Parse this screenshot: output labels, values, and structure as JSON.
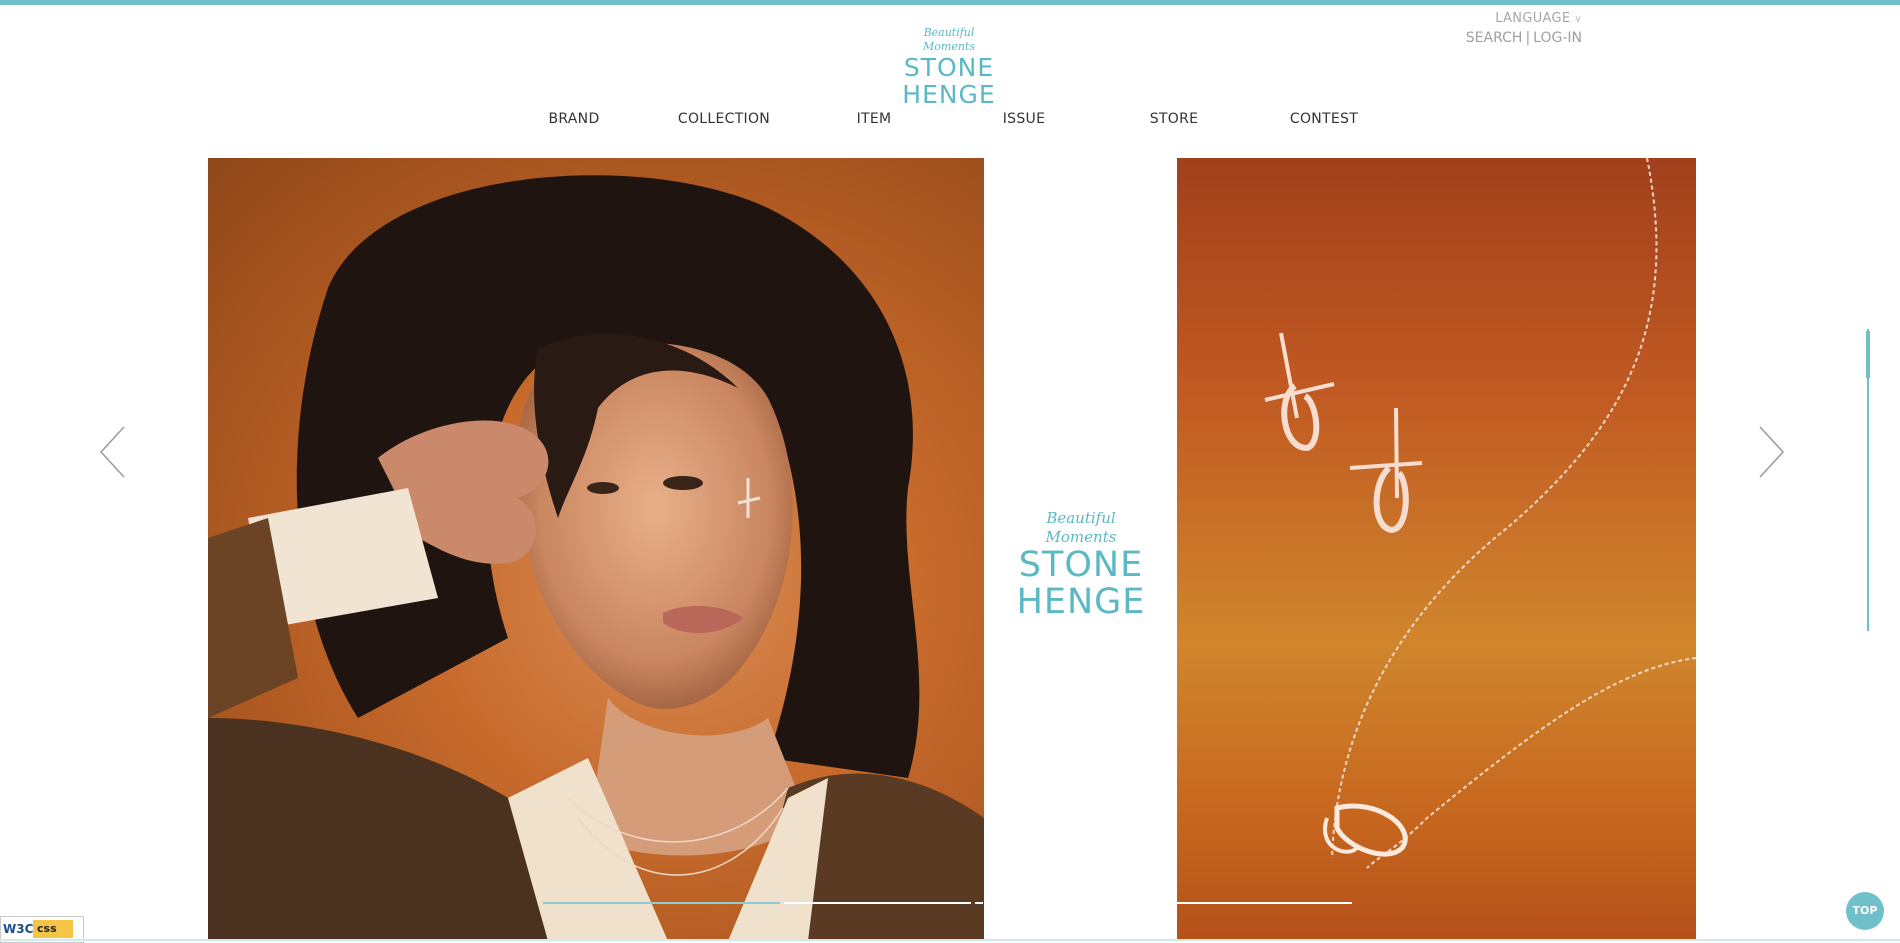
{
  "header": {
    "logo": {
      "tagline": "Beautiful Moments",
      "line1": "STONE",
      "line2": "HENGE"
    },
    "language": {
      "label": "LANGUAGE",
      "chevron": "∨"
    },
    "util_links": {
      "search": "SEARCH",
      "separator": "|",
      "login": "LOG-IN"
    }
  },
  "nav": {
    "items": [
      {
        "label": "BRAND"
      },
      {
        "label": "COLLECTION"
      },
      {
        "label": "ITEM"
      },
      {
        "label": "ISSUE"
      },
      {
        "label": "STORE"
      },
      {
        "label": "CONTEST"
      }
    ]
  },
  "slider": {
    "center_logo": {
      "tagline": "Beautiful Moments",
      "line1": "STONE",
      "line2": "HENGE"
    },
    "prev_icon": "chevron-left-icon",
    "next_icon": "chevron-right-icon",
    "active_index": 0,
    "slide_count": 4
  },
  "top_button": {
    "label": "TOP"
  },
  "badge": {
    "w3c": "W3C",
    "css": "css"
  },
  "colors": {
    "accent": "#6fc0cb",
    "nav_text": "#333333",
    "util_text": "#a0a0a0"
  }
}
